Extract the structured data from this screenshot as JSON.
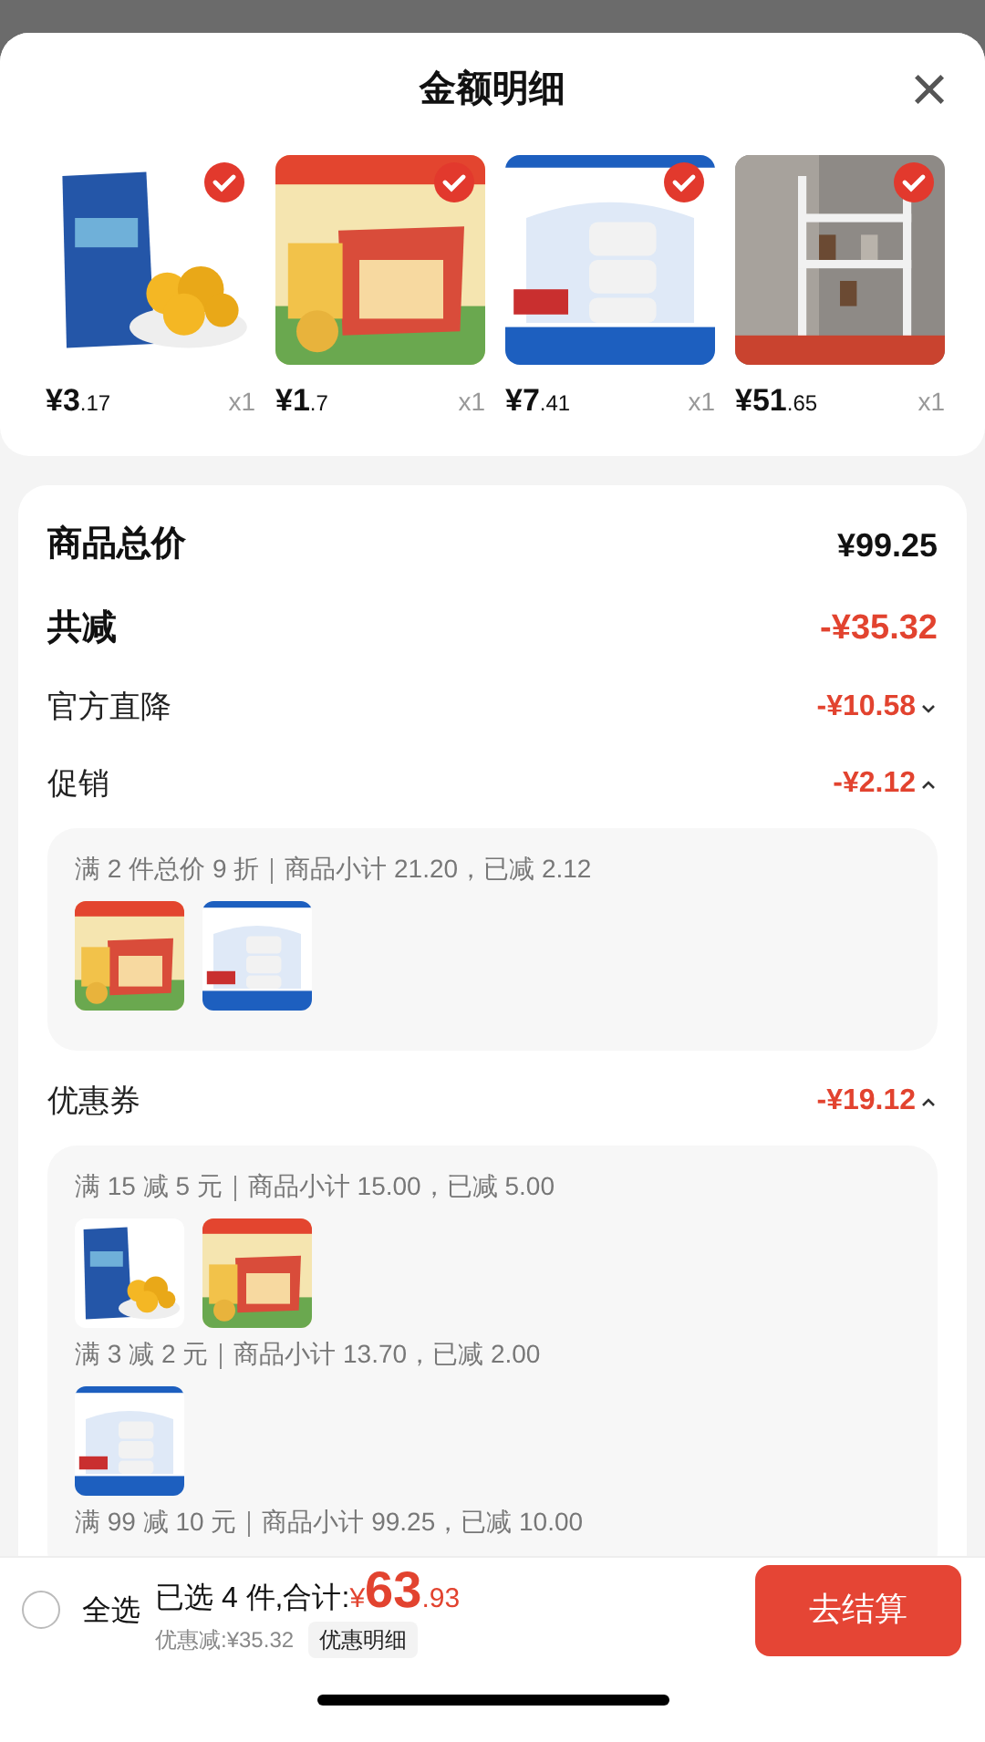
{
  "sheet": {
    "title": "金额明细",
    "close": "×"
  },
  "products": [
    {
      "price_main": "¥3",
      "price_fraction": ".17",
      "quantity": "x1",
      "checked": true
    },
    {
      "price_main": "¥1",
      "price_fraction": ".7",
      "quantity": "x1",
      "checked": true
    },
    {
      "price_main": "¥7",
      "price_fraction": ".41",
      "quantity": "x1",
      "checked": true
    },
    {
      "price_main": "¥51",
      "price_fraction": ".65",
      "quantity": "x1",
      "checked": true
    }
  ],
  "details": [
    {
      "kind": "total",
      "label": "商品总价",
      "amount": "¥99.25"
    },
    {
      "kind": "reduction",
      "label": "共减",
      "amount": "-¥35.32"
    },
    {
      "kind": "item",
      "label": "官方直降",
      "amount": "-¥10.58",
      "expanded": false
    },
    {
      "kind": "item",
      "label": "促销",
      "amount": "-¥2.12",
      "expanded": true,
      "groups": [
        {
          "text": "满 2 件总价 9 折｜商品小计 21.20，已减 2.12"
        }
      ]
    },
    {
      "kind": "item",
      "label": "优惠券",
      "amount": "-¥19.12",
      "expanded": true,
      "groups": [
        {
          "text": "满 15 减 5 元｜商品小计 15.00，已减 5.00"
        },
        {
          "text": "满 3 减 2 元｜商品小计 13.70，已减 2.00"
        },
        {
          "text": "满 99 减 10 元｜商品小计 99.25，已减 10.00"
        }
      ]
    }
  ],
  "footer": {
    "select_all": {
      "label": "全选",
      "checked": false
    },
    "summary": "已选 4 件,合计:",
    "currency": "¥",
    "total_main": "63",
    "total_fraction": ".93",
    "discount": "优惠减:¥35.32",
    "detail_chip": "优惠明细",
    "checkout": "去结算"
  }
}
